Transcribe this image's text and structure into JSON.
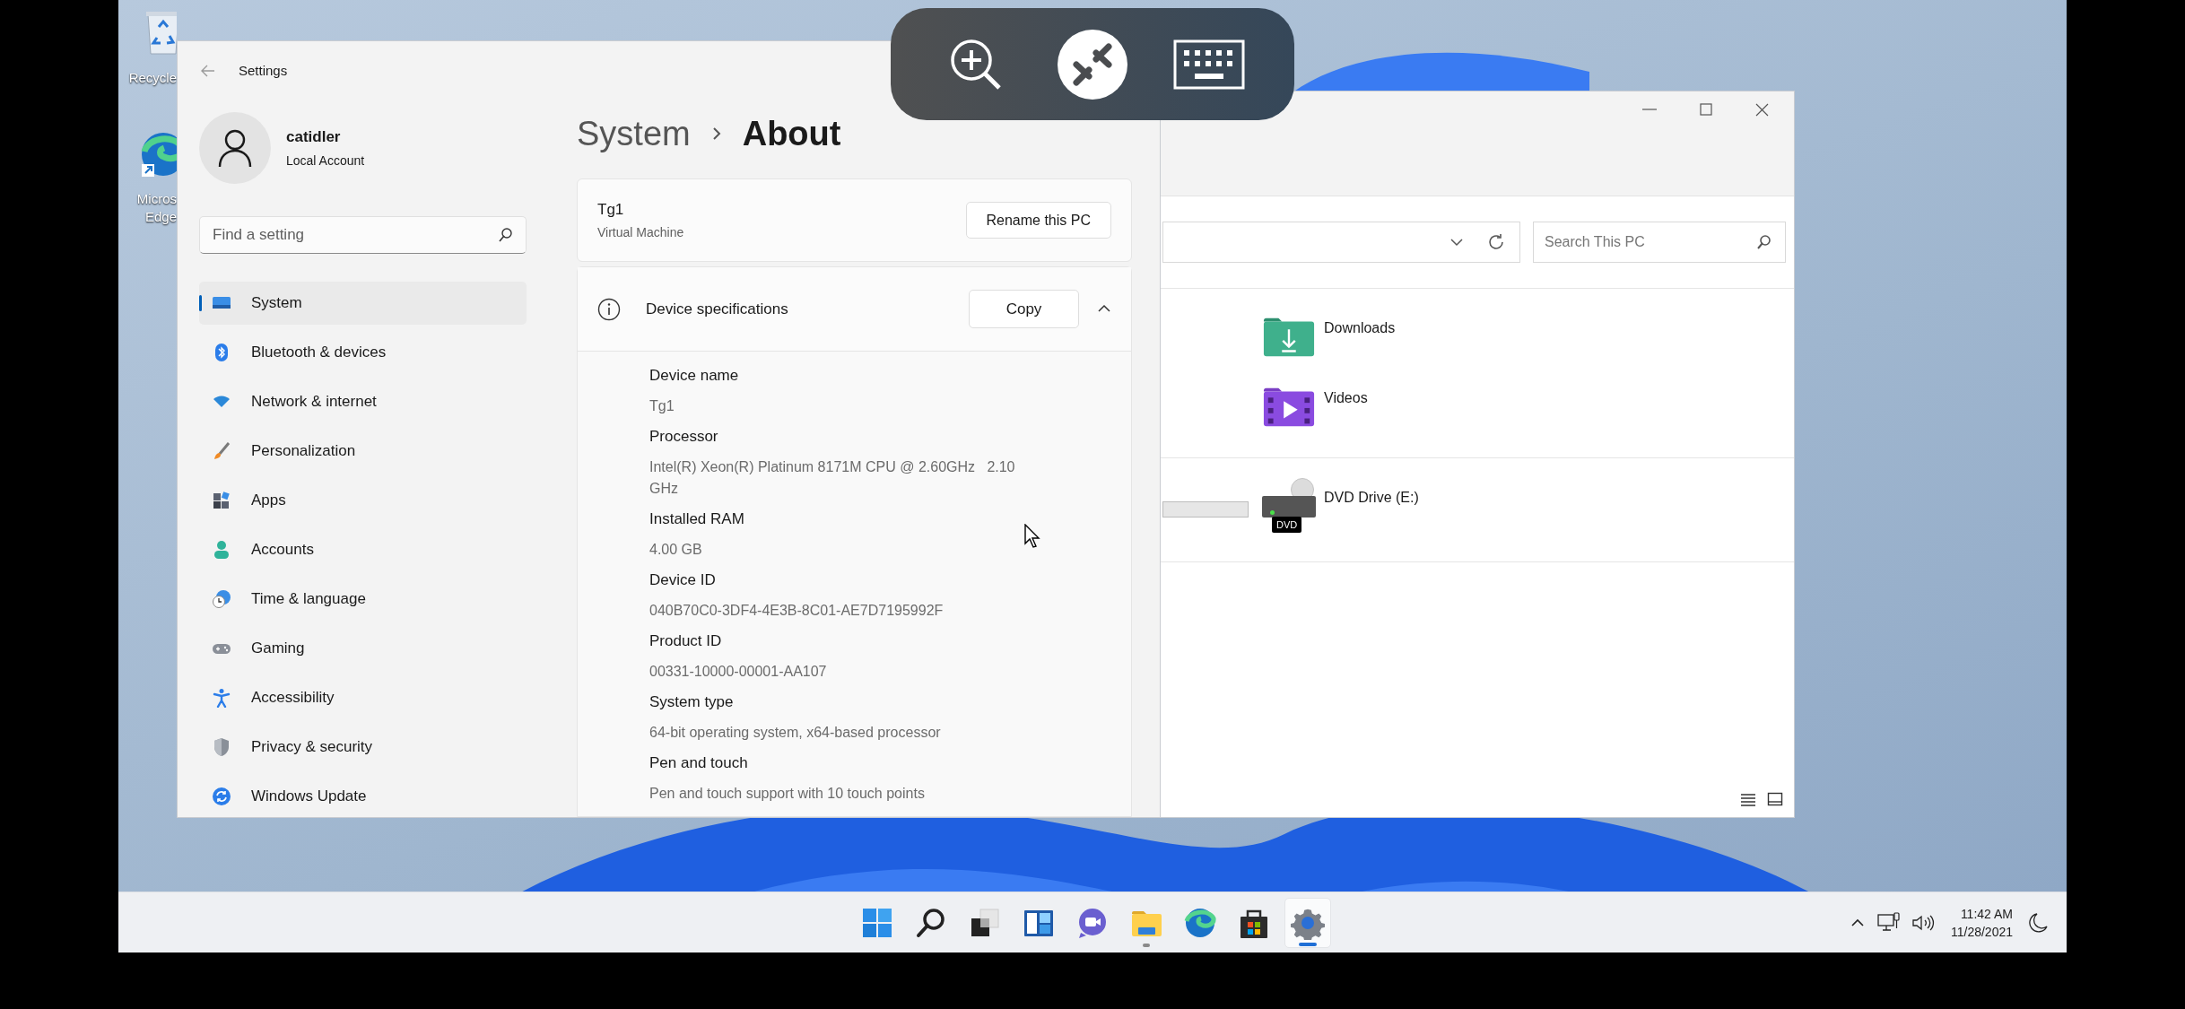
{
  "desktop_icons": [
    {
      "kind": "recycle",
      "labels": [
        "Recycle"
      ]
    },
    {
      "kind": "edge",
      "labels": [
        "Micros",
        "Edge"
      ]
    }
  ],
  "settings": {
    "title": "Settings",
    "account": {
      "name": "catidler",
      "type": "Local Account"
    },
    "search": {
      "placeholder": "Find a setting"
    },
    "nav": [
      {
        "kind": "system",
        "label": "System",
        "selected": true
      },
      {
        "kind": "bluetooth",
        "label": "Bluetooth & devices",
        "selected": false
      },
      {
        "kind": "network",
        "label": "Network & internet",
        "selected": false
      },
      {
        "kind": "personalization",
        "label": "Personalization",
        "selected": false
      },
      {
        "kind": "apps",
        "label": "Apps",
        "selected": false
      },
      {
        "kind": "accounts",
        "label": "Accounts",
        "selected": false
      },
      {
        "kind": "time",
        "label": "Time & language",
        "selected": false
      },
      {
        "kind": "gaming",
        "label": "Gaming",
        "selected": false
      },
      {
        "kind": "accessibility",
        "label": "Accessibility",
        "selected": false
      },
      {
        "kind": "privacy",
        "label": "Privacy & security",
        "selected": false
      },
      {
        "kind": "update",
        "label": "Windows Update",
        "selected": false
      }
    ],
    "breadcrumb": [
      "System",
      "About"
    ],
    "pc": {
      "name": "Tg1",
      "model": "Virtual Machine",
      "button": "Rename this PC"
    },
    "specs": {
      "title": "Device specifications",
      "button": "Copy",
      "expanded": true,
      "rows": [
        {
          "label": "Device name",
          "value": "Tg1"
        },
        {
          "label": "Processor",
          "value": "Intel(R) Xeon(R) Platinum 8171M CPU @ 2.60GHz   2.10 GHz"
        },
        {
          "label": "Installed RAM",
          "value": "4.00 GB"
        },
        {
          "label": "Device ID",
          "value": "040B70C0-3DF4-4E3B-8C01-AE7D7195992F"
        },
        {
          "label": "Product ID",
          "value": "00331-10000-00001-AA107"
        },
        {
          "label": "System type",
          "value": "64-bit operating system, x64-based processor"
        },
        {
          "label": "Pen and touch",
          "value": "Pen and touch support with 10 touch points"
        }
      ]
    }
  },
  "explorer": {
    "search": {
      "placeholder": "Search This PC"
    },
    "folders": [
      {
        "kind": "downloads",
        "label": "Downloads"
      },
      {
        "kind": "videos",
        "label": "Videos"
      }
    ],
    "drives": [
      {
        "kind": "dvd",
        "label": "DVD Drive (E:)",
        "badge": "DVD"
      }
    ]
  },
  "taskbar": {
    "apps": [
      {
        "kind": "start",
        "running": false,
        "active": false
      },
      {
        "kind": "search",
        "running": false,
        "active": false
      },
      {
        "kind": "taskview",
        "running": false,
        "active": false
      },
      {
        "kind": "widgets",
        "running": false,
        "active": false
      },
      {
        "kind": "chat",
        "running": false,
        "active": false
      },
      {
        "kind": "explorer",
        "running": true,
        "active": false
      },
      {
        "kind": "edge",
        "running": false,
        "active": false
      },
      {
        "kind": "store",
        "running": false,
        "active": false
      },
      {
        "kind": "settings",
        "running": true,
        "active": true
      }
    ],
    "clock": {
      "time": "11:42 AM",
      "date": "11/28/2021"
    }
  }
}
